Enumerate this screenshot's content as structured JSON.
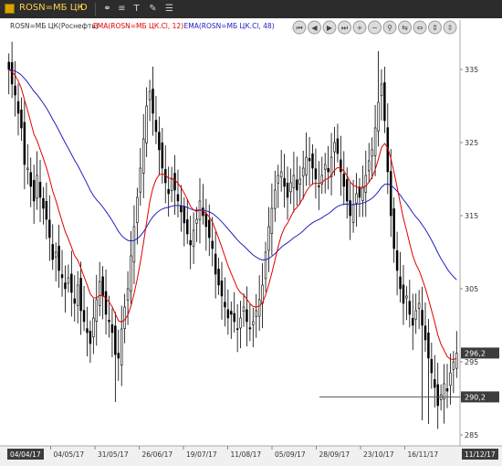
{
  "window": {
    "symbol": "ROSN=МБ ЦК",
    "period": "D"
  },
  "legend": [
    {
      "text": "ROSN=МБ ЦК(Роснефть)",
      "color": "#333333"
    },
    {
      "text": "EMA(ROSN=МБ ЦК.Cl, 12)",
      "color": "#e00000"
    },
    {
      "text": "EMA(ROSN=МБ ЦК.Cl, 48)",
      "color": "#2020c0"
    }
  ],
  "toolbar_icons": [
    "scroll-left-start-icon",
    "scroll-left-icon",
    "scroll-right-icon",
    "scroll-right-end-icon",
    "zoom-in-icon",
    "zoom-out-icon",
    "zoom-fit-icon",
    "compress-icon",
    "expand-icon",
    "vertical-compress-icon",
    "vertical-expand-icon"
  ],
  "colors": {
    "background": "#ffffff",
    "candle": "#000000",
    "ema_fast": "#e00000",
    "ema_slow": "#2020c0",
    "current_label_bg": "#3c3c3c",
    "level_label_bg": "#3c3c3c",
    "level_line": "#555555"
  },
  "chart_data": {
    "type": "candlestick",
    "title": "ROSN=МБ ЦК(Роснефть)",
    "x_labels": [
      "04/04/17",
      "04/05/17",
      "31/05/17",
      "26/06/17",
      "19/07/17",
      "11/08/17",
      "05/09/17",
      "28/09/17",
      "23/10/17",
      "16/11/17",
      "11/12/17"
    ],
    "y_ticks": [
      285,
      295,
      305,
      315,
      325,
      335
    ],
    "ylim": [
      284,
      340
    ],
    "grid": false,
    "current_value": "296,2",
    "level_value": "290,2",
    "close_series": [
      335.0,
      333.0,
      331.5,
      329.0,
      327.0,
      322.0,
      321.5,
      319.0,
      317.0,
      320.5,
      317.5,
      316.0,
      314.5,
      312.0,
      309.0,
      310.0,
      307.5,
      306.5,
      305.0,
      306.5,
      304.5,
      303.0,
      305.5,
      302.0,
      300.5,
      299.0,
      297.5,
      301.0,
      303.5,
      306.0,
      304.0,
      301.5,
      300.5,
      299.0,
      296.0,
      295.5,
      299.5,
      302.5,
      305.0,
      309.5,
      313.5,
      317.5,
      321.5,
      325.5,
      330.0,
      332.0,
      329.0,
      326.5,
      324.0,
      321.5,
      319.5,
      318.0,
      320.0,
      318.5,
      317.0,
      315.5,
      314.0,
      312.5,
      311.0,
      313.0,
      314.5,
      317.0,
      315.0,
      313.5,
      312.0,
      310.5,
      307.0,
      305.5,
      304.0,
      302.5,
      301.0,
      301.5,
      300.5,
      299.5,
      301.0,
      302.5,
      300.5,
      299.5,
      300.5,
      302.0,
      303.5,
      305.5,
      310.0,
      313.5,
      316.0,
      318.5,
      320.5,
      321.0,
      319.0,
      317.5,
      319.5,
      320.5,
      318.5,
      320.0,
      321.5,
      323.0,
      322.5,
      321.5,
      320.0,
      319.0,
      320.5,
      322.0,
      321.0,
      323.0,
      325.0,
      323.5,
      321.0,
      319.0,
      317.0,
      315.0,
      316.5,
      318.0,
      317.5,
      319.0,
      320.5,
      322.5,
      324.0,
      327.0,
      330.5,
      333.0,
      328.0,
      321.0,
      315.0,
      310.5,
      307.5,
      305.0,
      303.0,
      304.0,
      301.5,
      300.0,
      302.0,
      303.0,
      300.0,
      298.0,
      295.5,
      293.5,
      291.5,
      289.0,
      290.5,
      292.0,
      291.0,
      293.5,
      295.0,
      296.2
    ],
    "series": [
      {
        "name": "EMA(ROSN=МБ ЦК.Cl, 12)",
        "type": "line",
        "period": 12
      },
      {
        "name": "EMA(ROSN=МБ ЦК.Cl, 48)",
        "type": "line",
        "period": 48
      }
    ]
  }
}
